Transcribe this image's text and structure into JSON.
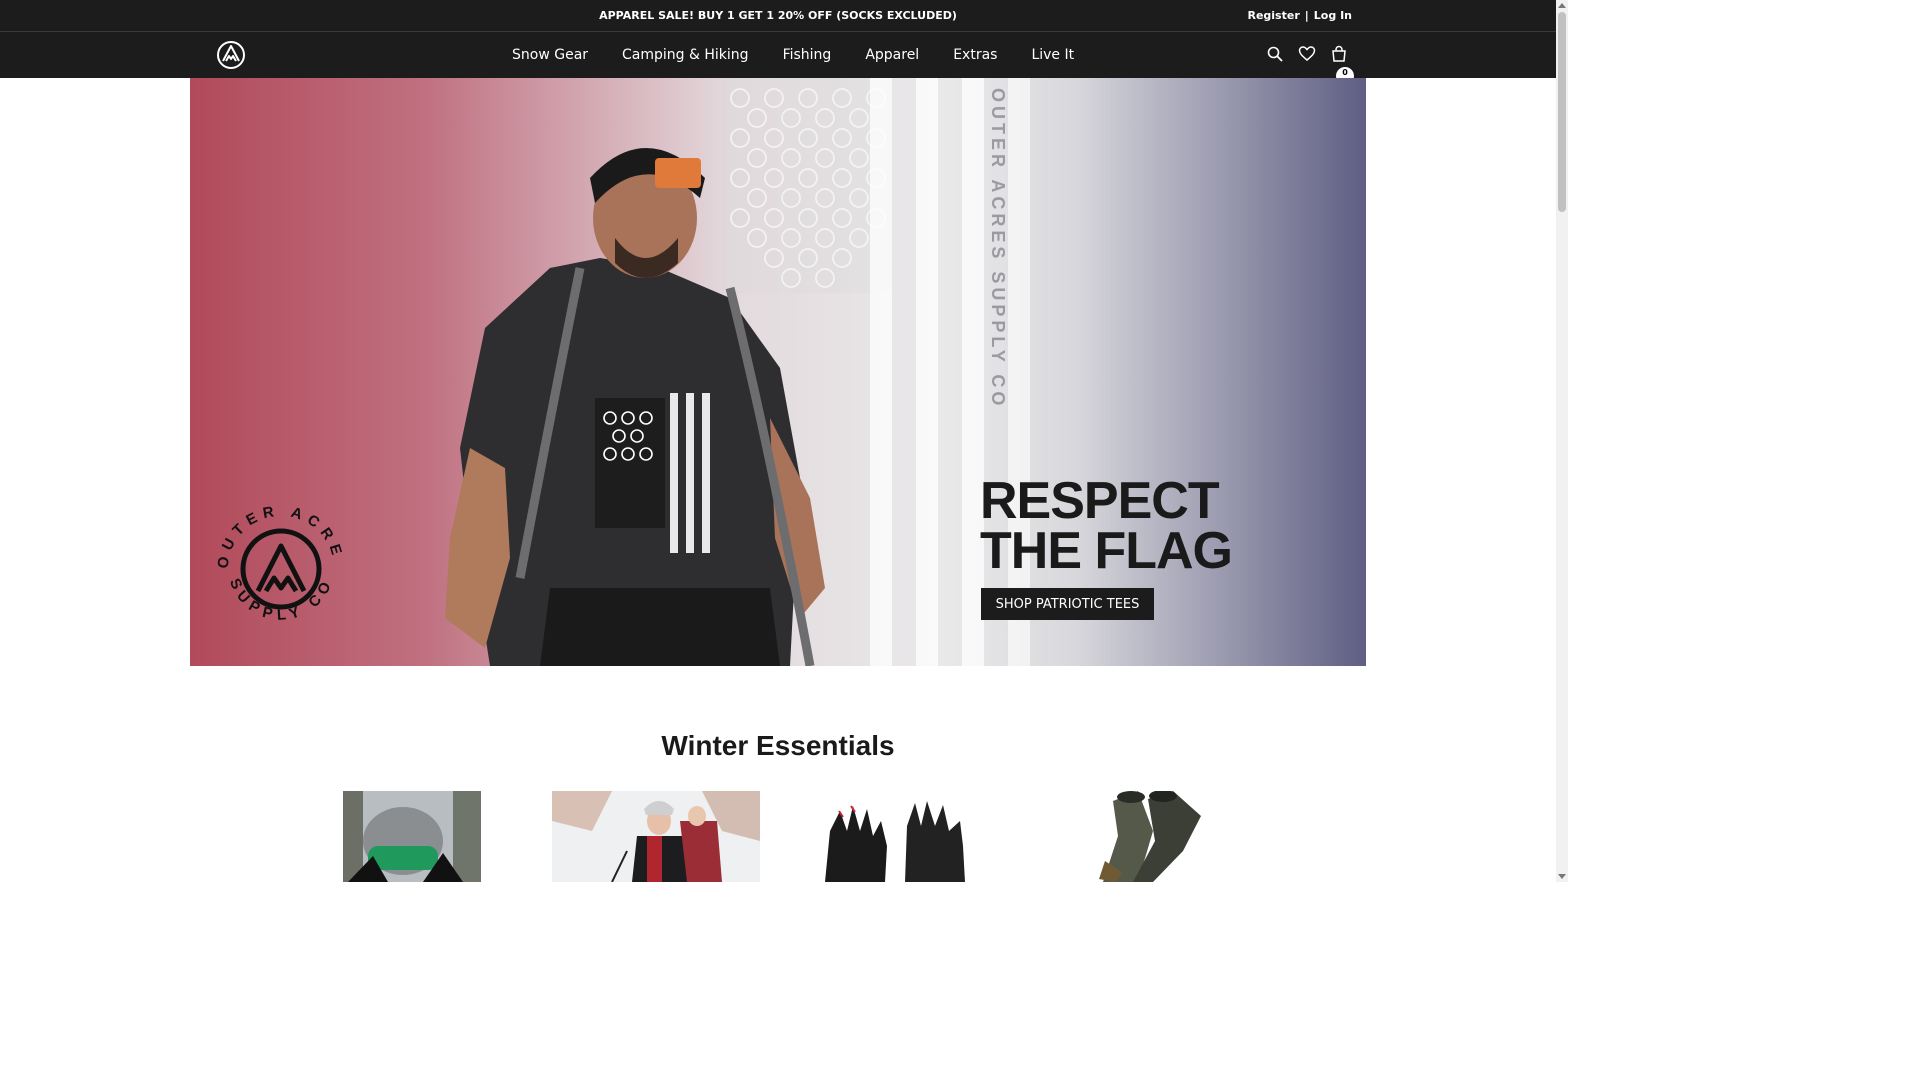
{
  "promo": {
    "message": "APPAREL SALE! BUY 1 GET 1 20% OFF (SOCKS EXCLUDED)",
    "register": "Register",
    "separator": "|",
    "login": "Log In"
  },
  "nav": {
    "items": [
      "Snow Gear",
      "Camping & Hiking",
      "Fishing",
      "Apparel",
      "Extras",
      "Live It"
    ],
    "cart_count": "0"
  },
  "hero": {
    "headline_line1": "RESPECT",
    "headline_line2": "THE FLAG",
    "cta": "SHOP PATRIOTIC TEES",
    "badge_text_top": "OUTER ACRES",
    "badge_text_bottom": "SUPPLY CO",
    "stripe_text": "OUTER ACRES SUPPLY CO"
  },
  "section": {
    "title": "Winter Essentials"
  },
  "colors": {
    "bar": "#1c1c1c",
    "hero_red": "#b14a5a",
    "hero_blue": "#5f5e83"
  }
}
